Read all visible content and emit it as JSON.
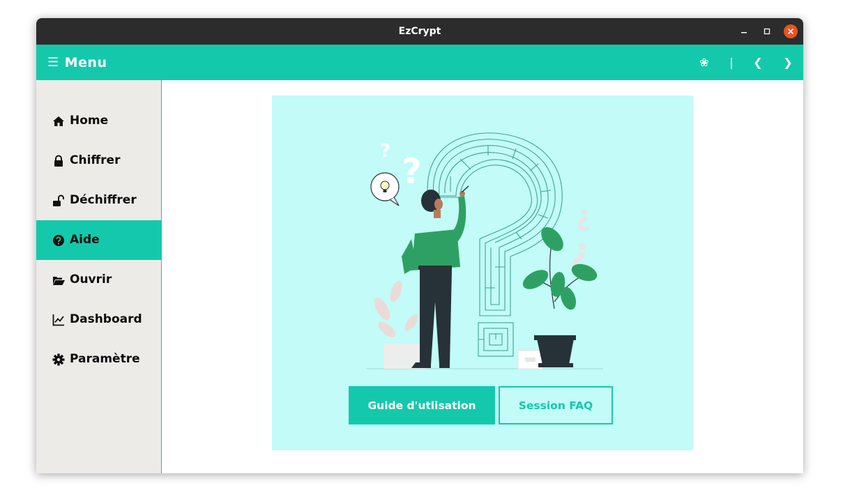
{
  "window": {
    "title": "EzCrypt"
  },
  "colors": {
    "accent": "#14c9ab",
    "sidebar_bg": "#edebe8",
    "card_bg": "#c2fbf7",
    "titlebar_bg": "#2c2c2c",
    "close_btn": "#e95420"
  },
  "header": {
    "menu_icon": "☰",
    "menu_label": "Menu",
    "icons": [
      {
        "name": "theme-icon",
        "glyph": "❀"
      },
      {
        "name": "separator-icon",
        "glyph": "|"
      },
      {
        "name": "back-icon",
        "glyph": "❮"
      },
      {
        "name": "forward-icon",
        "glyph": "❯"
      }
    ]
  },
  "sidebar": {
    "items": [
      {
        "label": "Home",
        "icon": "home-icon",
        "active": false
      },
      {
        "label": "Chiffrer",
        "icon": "lock-icon",
        "active": false
      },
      {
        "label": "Déchiffrer",
        "icon": "unlock-icon",
        "active": false
      },
      {
        "label": "Aide",
        "icon": "question-circle-icon",
        "active": true
      },
      {
        "label": "Ouvrir",
        "icon": "folder-open-icon",
        "active": false
      },
      {
        "label": "Dashboard",
        "icon": "line-chart-icon",
        "active": false
      },
      {
        "label": "Paramètre",
        "icon": "gear-icon",
        "active": false
      }
    ]
  },
  "main": {
    "illustration": "help-maze-illustration",
    "buttons": {
      "guide_label": "Guide d'utlisation",
      "faq_label": "Session FAQ"
    }
  }
}
